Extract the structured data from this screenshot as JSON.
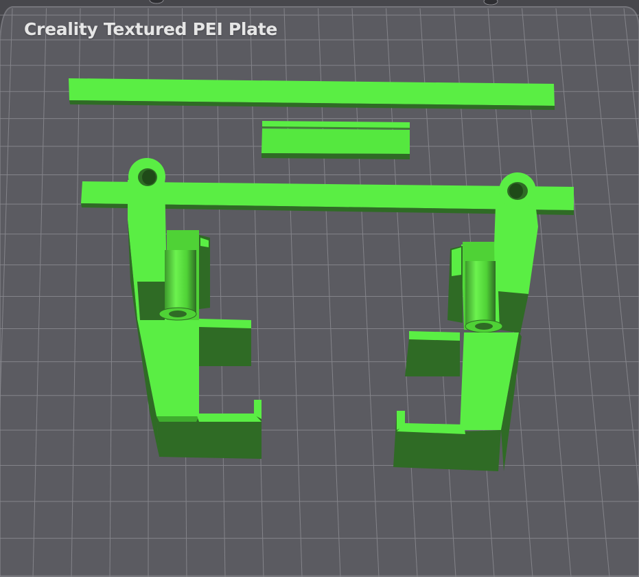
{
  "plate": {
    "label": "Creality Textured PEI Plate"
  },
  "colors": {
    "background": "#47474c",
    "plate_surface": "#5a5a60",
    "grid_line": "#8a8a90",
    "part_top": "#58ec42",
    "part_side": "#2f6b25",
    "part_edge": "#3fae2e"
  },
  "objects": [
    "long-bar-top",
    "short-bar-middle",
    "long-bar-lower",
    "left-bracket-part",
    "right-bracket-part"
  ]
}
